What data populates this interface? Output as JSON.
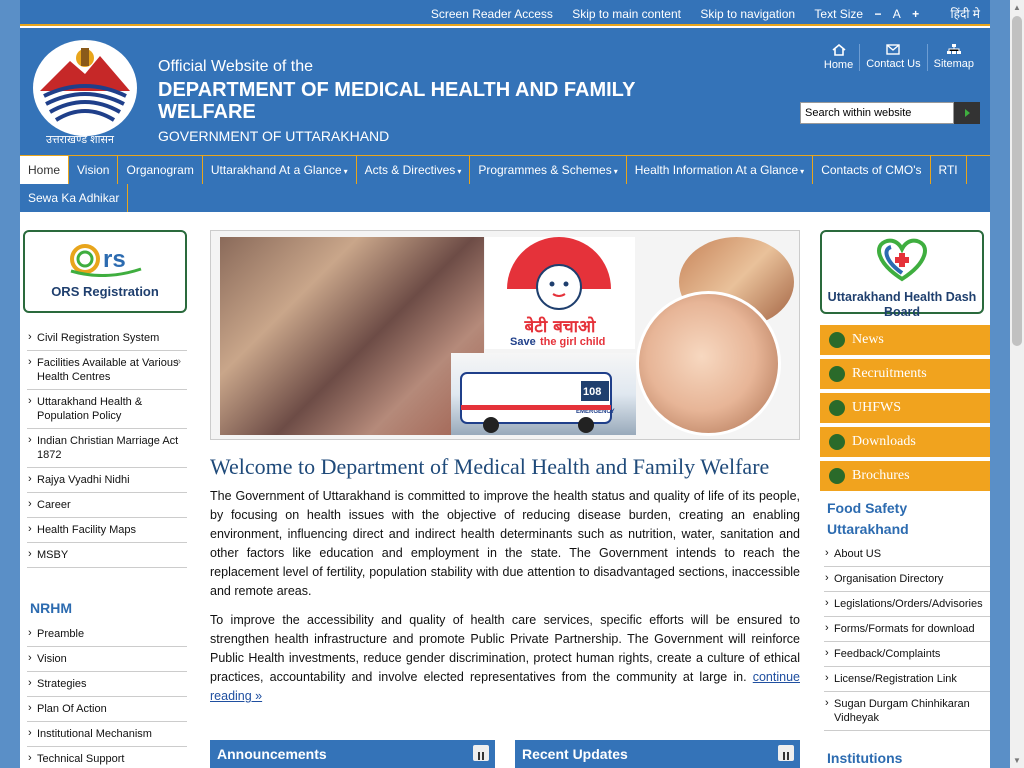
{
  "topbar": {
    "screen_reader": "Screen Reader Access",
    "skip_main": "Skip to main content",
    "skip_nav": "Skip to navigation",
    "text_size": "Text Size",
    "minus": "−",
    "a": "A",
    "plus": "+",
    "hindi": "हिंदी मे"
  },
  "header": {
    "line1": "Official Website of the",
    "line2": "DEPARTMENT OF MEDICAL HEALTH AND FAMILY WELFARE",
    "line3": "GOVERNMENT OF UTTARAKHAND",
    "logo_caption": "उत्तराखण्ड शासन",
    "nav": {
      "home": "Home",
      "contact": "Contact Us",
      "sitemap": "Sitemap"
    },
    "search_placeholder": "Search within website"
  },
  "menu": {
    "row1": [
      {
        "label": "Home",
        "dd": ""
      },
      {
        "label": "Vision",
        "dd": ""
      },
      {
        "label": "Organogram",
        "dd": ""
      },
      {
        "label": "Uttarakhand At a Glance",
        "dd": "▾"
      },
      {
        "label": "Acts & Directives",
        "dd": "▾"
      },
      {
        "label": "Programmes & Schemes",
        "dd": "▾"
      },
      {
        "label": "Health Information At a Glance",
        "dd": "▾"
      },
      {
        "label": "Contacts of CMO's",
        "dd": ""
      },
      {
        "label": "RTI",
        "dd": ""
      }
    ],
    "row2": [
      {
        "label": "Sewa Ka Adhikar",
        "dd": ""
      }
    ]
  },
  "left": {
    "ors_label": "ORS Registration",
    "ors_logo_text": "rs",
    "items": [
      "Civil Registration System",
      "Facilities Available at Various Health Centres",
      "Uttarakhand Health & Population Policy",
      "Indian Christian Marriage Act 1872",
      "Rajya Vyadhi Nidhi",
      "Career",
      "Health Facility Maps",
      "MSBY"
    ],
    "facility_arrow": "»",
    "nrhm_title": "NRHM",
    "nrhm_items": [
      "Preamble",
      "Vision",
      "Strategies",
      "Plan Of Action",
      "Institutional Mechanism",
      "Technical Support"
    ]
  },
  "center": {
    "banner": {
      "beti_hindi": "बेटी बचाओ",
      "beti_en_save": "Save",
      "beti_en_rest": "the girl child",
      "amb_number": "108",
      "amb_text": "EMERGENCY"
    },
    "welcome": "Welcome to  Department of Medical Health and Family Welfare",
    "para1": "The Government of Uttarakhand is committed to improve the health status and quality of life of its people, by focusing on health issues with the objective of reducing disease burden, creating an enabling environment, influencing direct and indirect health determinants such as nutrition, water, sanitation and other factors like education and employment in the state. The Government intends to reach the replacement level of fertility, population stability with due attention to disadvantaged sections, inaccessible and remote areas.",
    "para2": "To improve the accessibility and quality of health care services, specific efforts will be ensured to strengthen health infrastructure and promote Public Private Partnership. The Government will reinforce Public Health investments, reduce gender discrimination, protect human rights, create a culture of ethical practices, accountability and involve elected representatives from the community at large in.",
    "continue": "continue reading »",
    "announcements": "Announcements",
    "recent_updates": "Recent Updates"
  },
  "right": {
    "dash_label": "Uttarakhand Health Dash Board",
    "buttons": [
      "News",
      "Recruitments",
      "UHFWS",
      "Downloads",
      "Brochures"
    ],
    "fs_title": "Food Safety Uttarakhand",
    "fs_items": [
      "About US",
      "Organisation Directory",
      "Legislations/Orders/Advisories",
      "Forms/Formats for download",
      "Feedback/Complaints",
      "License/Registration Link",
      "Sugan Durgam Chinhikaran Vidheyak"
    ],
    "institutions": "Institutions"
  },
  "colors": {
    "primary_blue": "#3473b8",
    "accent_orange": "#f1a31e",
    "heading_blue": "#2c6bb0"
  }
}
